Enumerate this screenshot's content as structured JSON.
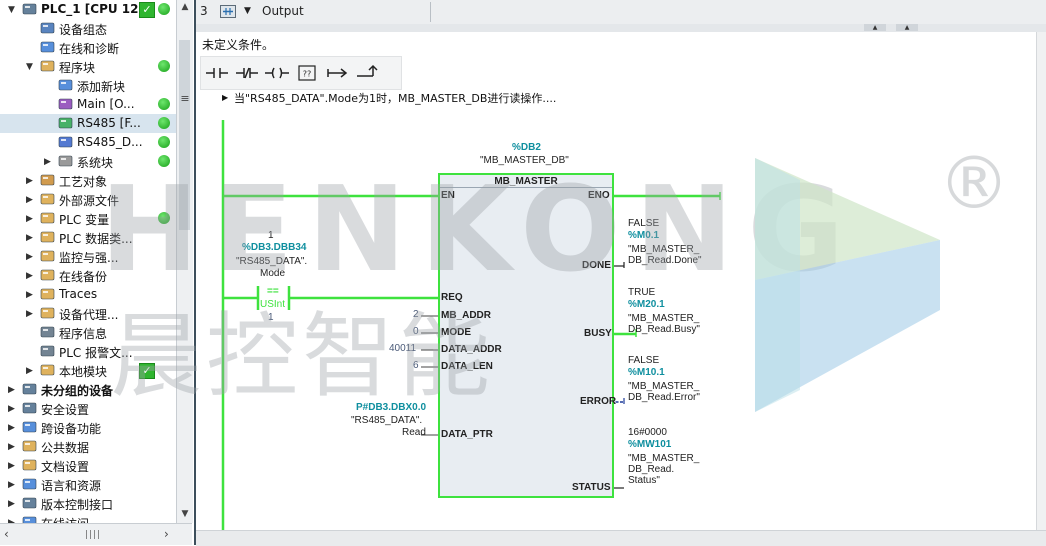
{
  "tree": {
    "items": [
      {
        "label": "PLC_1 [CPU 12...",
        "indent": 0,
        "arrow": "▼",
        "icon": "plc-icon",
        "status": "check+green",
        "bold": true
      },
      {
        "label": "设备组态",
        "indent": 1,
        "arrow": "",
        "icon": "device-config-icon",
        "status": ""
      },
      {
        "label": "在线和诊断",
        "indent": 1,
        "arrow": "",
        "icon": "online-diagnostics-icon",
        "status": ""
      },
      {
        "label": "程序块",
        "indent": 1,
        "arrow": "▼",
        "icon": "folder-icon",
        "status": "green"
      },
      {
        "label": "添加新块",
        "indent": 2,
        "arrow": "",
        "icon": "add-block-icon",
        "status": ""
      },
      {
        "label": "Main [O...",
        "indent": 2,
        "arrow": "",
        "icon": "ob-block-icon",
        "status": "green"
      },
      {
        "label": "RS485 [F...",
        "indent": 2,
        "arrow": "",
        "icon": "fb-block-icon",
        "status": "green",
        "selected": true
      },
      {
        "label": "RS485_D...",
        "indent": 2,
        "arrow": "",
        "icon": "db-block-icon",
        "status": "green"
      },
      {
        "label": "系统块",
        "indent": 2,
        "arrow": "▶",
        "icon": "system-block-icon",
        "status": "green"
      },
      {
        "label": "工艺对象",
        "indent": 1,
        "arrow": "▶",
        "icon": "technology-objects-icon",
        "status": ""
      },
      {
        "label": "外部源文件",
        "indent": 1,
        "arrow": "▶",
        "icon": "external-source-icon",
        "status": ""
      },
      {
        "label": "PLC 变量",
        "indent": 1,
        "arrow": "▶",
        "icon": "plc-tags-icon",
        "status": "green"
      },
      {
        "label": "PLC 数据类...",
        "indent": 1,
        "arrow": "▶",
        "icon": "plc-datatypes-icon",
        "status": ""
      },
      {
        "label": "监控与强...",
        "indent": 1,
        "arrow": "▶",
        "icon": "watch-force-icon",
        "status": ""
      },
      {
        "label": "在线备份",
        "indent": 1,
        "arrow": "▶",
        "icon": "online-backup-icon",
        "status": ""
      },
      {
        "label": "Traces",
        "indent": 1,
        "arrow": "▶",
        "icon": "traces-icon",
        "status": ""
      },
      {
        "label": "设备代理...",
        "indent": 1,
        "arrow": "▶",
        "icon": "device-proxy-icon",
        "status": ""
      },
      {
        "label": "程序信息",
        "indent": 1,
        "arrow": "",
        "icon": "program-info-icon",
        "status": ""
      },
      {
        "label": "PLC 报警文...",
        "indent": 1,
        "arrow": "",
        "icon": "alarm-text-icon",
        "status": ""
      },
      {
        "label": "本地模块",
        "indent": 1,
        "arrow": "▶",
        "icon": "local-modules-icon",
        "status": "check"
      },
      {
        "label": "未分组的设备",
        "indent": 0,
        "arrow": "▶",
        "icon": "ungrouped-devices-icon",
        "status": "",
        "bold": true
      },
      {
        "label": "安全设置",
        "indent": 0,
        "arrow": "▶",
        "icon": "security-settings-icon",
        "status": ""
      },
      {
        "label": "跨设备功能",
        "indent": 0,
        "arrow": "▶",
        "icon": "cross-device-icon",
        "status": ""
      },
      {
        "label": "公共数据",
        "indent": 0,
        "arrow": "▶",
        "icon": "common-data-icon",
        "status": ""
      },
      {
        "label": "文档设置",
        "indent": 0,
        "arrow": "▶",
        "icon": "document-settings-icon",
        "status": ""
      },
      {
        "label": "语言和资源",
        "indent": 0,
        "arrow": "▶",
        "icon": "languages-resources-icon",
        "status": ""
      },
      {
        "label": "版本控制接口",
        "indent": 0,
        "arrow": "▶",
        "icon": "version-control-icon",
        "status": ""
      },
      {
        "label": "在线访问",
        "indent": 0,
        "arrow": "▶",
        "icon": "online-access-icon",
        "status": ""
      }
    ]
  },
  "network": {
    "number": "3",
    "title": "Output",
    "condition_text": "未定义条件。",
    "comment": "当\"RS485_DATA\".Mode为1时，MB_MASTER_DB进行读操作...."
  },
  "toolbar": {
    "buttons": [
      {
        "name": "no-contact-button",
        "glyph": "-| |-"
      },
      {
        "name": "nc-contact-button",
        "glyph": "-|/|-"
      },
      {
        "name": "coil-button",
        "glyph": "-( )-"
      },
      {
        "name": "empty-box-button",
        "glyph": "??"
      },
      {
        "name": "open-branch-button",
        "glyph": "↦"
      },
      {
        "name": "close-branch-button",
        "glyph": "↱"
      }
    ]
  },
  "ladder": {
    "contact": {
      "value": "1",
      "address": "%DB3.DBB34",
      "tag": "\"RS485_DATA\".",
      "tag2": "Mode",
      "operator": "==",
      "type": "USInt",
      "compare_value": "1"
    },
    "block": {
      "instance_address": "%DB2",
      "instance_name": "\"MB_MASTER_DB\"",
      "name": "MB_MASTER",
      "inputs": [
        {
          "pin": "EN",
          "value": ""
        },
        {
          "pin": "REQ",
          "value": ""
        },
        {
          "pin": "MB_ADDR",
          "value": "2"
        },
        {
          "pin": "MODE",
          "value": "0"
        },
        {
          "pin": "DATA_ADDR",
          "value": "40011"
        },
        {
          "pin": "DATA_LEN",
          "value": "6"
        },
        {
          "pin": "DATA_PTR",
          "value": ""
        }
      ],
      "outputs": [
        {
          "pin": "ENO"
        },
        {
          "pin": "DONE"
        },
        {
          "pin": "BUSY"
        },
        {
          "pin": "ERROR"
        },
        {
          "pin": "STATUS"
        }
      ]
    },
    "data_ptr": {
      "address": "P#DB3.DBX0.0",
      "tag": "\"RS485_DATA\".",
      "tag2": "Read"
    },
    "done_out": {
      "state": "FALSE",
      "address": "%M0.1",
      "line1": "\"MB_MASTER_",
      "line2": "DB_Read.Done\""
    },
    "busy_out": {
      "state": "TRUE",
      "address": "%M20.1",
      "line1": "\"MB_MASTER_",
      "line2": "DB_Read.Busy\""
    },
    "error_out": {
      "state": "FALSE",
      "address": "%M10.1",
      "line1": "\"MB_MASTER_",
      "line2": "DB_Read.Error\""
    },
    "status_out": {
      "state": "16#0000",
      "address": "%MW101",
      "line1": "\"MB_MASTER_",
      "line2": "DB_Read.",
      "line3": "Status\""
    }
  },
  "watermark": {
    "latin": "HENKONG",
    "chinese": "晨控智能",
    "registered": "®"
  },
  "colors": {
    "power_flow": "#3ee23e",
    "tag_teal": "#0f8f9f",
    "block_fill": "#e8edf2"
  }
}
